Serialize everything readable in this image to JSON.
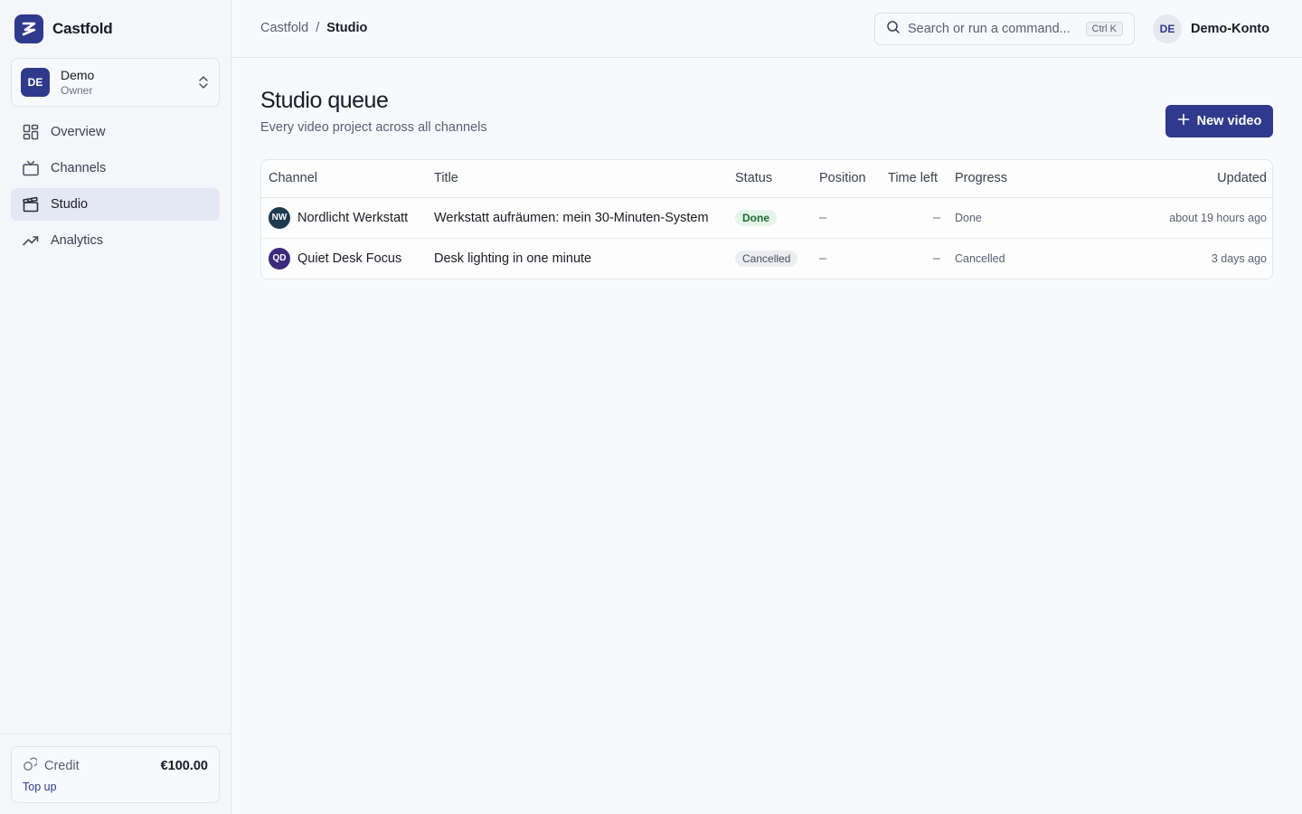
{
  "app": {
    "name": "Castfold"
  },
  "workspace": {
    "initials": "DE",
    "name": "Demo",
    "role": "Owner"
  },
  "sidebar": {
    "items": [
      {
        "label": "Overview",
        "icon": "grid-icon",
        "active": false
      },
      {
        "label": "Channels",
        "icon": "tv-icon",
        "active": false
      },
      {
        "label": "Studio",
        "icon": "clapperboard-icon",
        "active": true
      },
      {
        "label": "Analytics",
        "icon": "trending-up-icon",
        "active": false
      }
    ]
  },
  "credit": {
    "label": "Credit",
    "value": "€100.00",
    "topup_label": "Top up"
  },
  "header": {
    "breadcrumb": [
      "Castfold",
      "/",
      "Studio"
    ],
    "search_placeholder": "Search or run a command...",
    "shortcut": "Ctrl K",
    "user_initials": "DE",
    "user_name": "Demo-Konto"
  },
  "main": {
    "title": "Studio queue",
    "subtitle": "Every video project across all channels",
    "new_button_label": "New video"
  },
  "table": {
    "columns": [
      "Channel",
      "Title",
      "Status",
      "Position",
      "Time left",
      "Progress",
      "Updated"
    ],
    "rows": [
      {
        "channel_initials": "NW",
        "channel": "Nordlicht Werkstatt",
        "channel_color": "#1e3a4f",
        "title": "Werkstatt aufräumen: mein 30-Minuten-System",
        "status": "Done",
        "position": "–",
        "time_left": "–",
        "progress": "Done",
        "updated": "about 19 hours ago"
      },
      {
        "channel_initials": "QD",
        "channel": "Quiet Desk Focus",
        "channel_color": "#3b2a7a",
        "title": "Desk lighting in one minute",
        "status": "Cancelled",
        "position": "–",
        "time_left": "–",
        "progress": "Cancelled",
        "updated": "3 days ago"
      }
    ]
  },
  "colors": {
    "brand": "#2f3a8c",
    "done_badge_bg": "#e3f5e8",
    "done_badge_text": "#1d6b35"
  }
}
